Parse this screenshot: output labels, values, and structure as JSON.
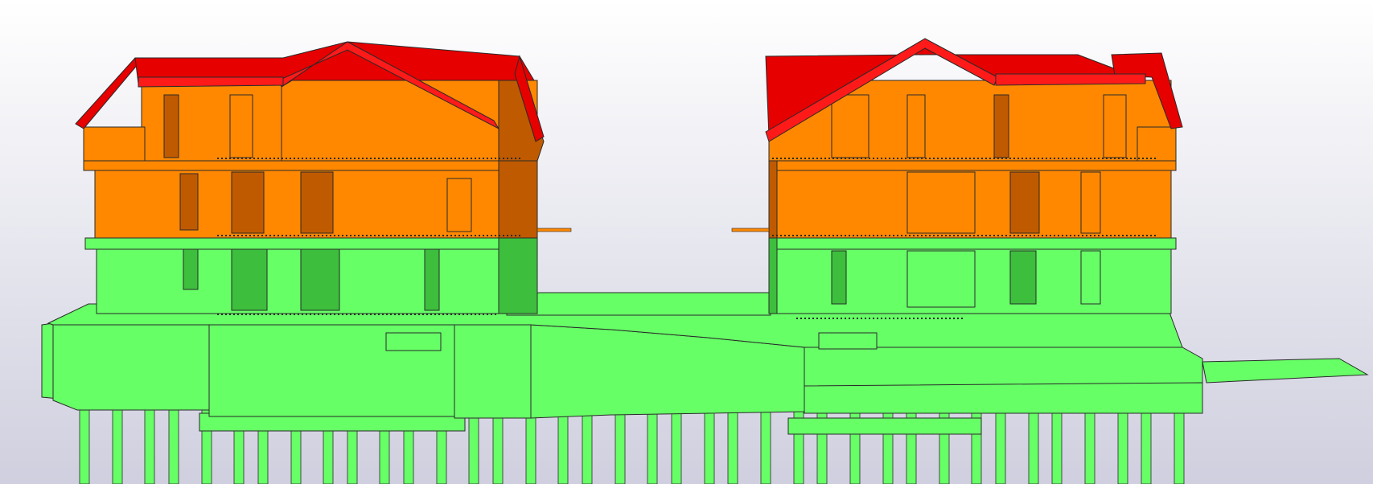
{
  "viewport": {
    "background_top": "#FFFFFF",
    "background_bottom": "#CFCFDF"
  },
  "legend_colors": {
    "ground_floor_concrete": "#66FF66",
    "ground_floor_shadow": "#3DBE3D",
    "upper_floors": "#FF8800",
    "upper_floors_shadow": "#C05A00",
    "roof": "#E60000",
    "roof_highlight": "#FF1A1A",
    "outline": "#2A2A2A"
  },
  "model": {
    "buildings": [
      {
        "id": "left-building",
        "floors": 3,
        "roof": "gable"
      },
      {
        "id": "right-building",
        "floors": 3,
        "roof": "gable"
      }
    ],
    "podium": {
      "id": "podium-slab"
    },
    "piles": {
      "count": 38
    }
  }
}
